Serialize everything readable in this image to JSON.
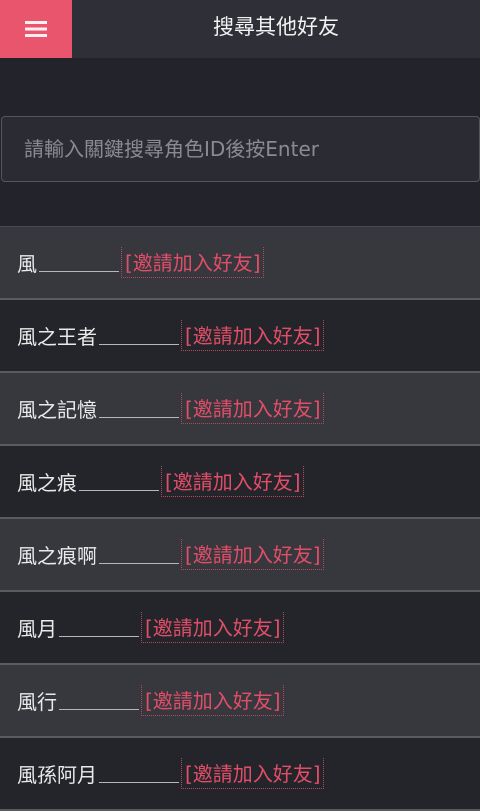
{
  "header": {
    "title": "搜尋其他好友",
    "menu_icon": "hamburger-menu-icon",
    "accent_color": "#e9556d"
  },
  "search": {
    "placeholder": "請輸入關鍵搜尋角色ID後按Enter",
    "value": ""
  },
  "results": {
    "invite_label": "[邀請加入好友]",
    "items": [
      {
        "name": "風"
      },
      {
        "name": "風之王者"
      },
      {
        "name": "風之記憶"
      },
      {
        "name": "風之痕"
      },
      {
        "name": "風之痕啊"
      },
      {
        "name": "風月"
      },
      {
        "name": "風行"
      },
      {
        "name": "風孫阿月"
      }
    ]
  }
}
